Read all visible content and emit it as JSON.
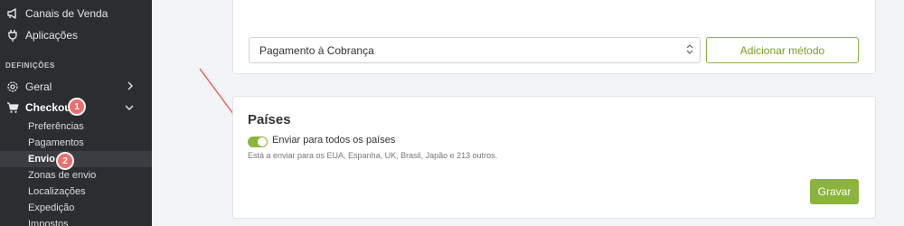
{
  "sidebar": {
    "top_items": [
      {
        "label": "Canais de Venda",
        "icon": "megaphone-icon"
      },
      {
        "label": "Aplicações",
        "icon": "plug-icon"
      }
    ],
    "section_label": "DEFINIÇÕES",
    "items": [
      {
        "label": "Geral",
        "icon": "gear-icon"
      },
      {
        "label": "Checkout",
        "icon": "cart-icon"
      }
    ],
    "checkout_children": [
      "Preferências",
      "Pagamentos",
      "Envio",
      "Zonas de envio",
      "Localizações",
      "Expedição",
      "Impostos"
    ],
    "badges": [
      "1",
      "2"
    ]
  },
  "payment": {
    "selected": "Pagamento à Cobrança",
    "add_button": "Adicionar método"
  },
  "countries": {
    "title": "Países",
    "toggle_label": "Enviar para todos os países",
    "toggle_on": true,
    "hint": "Está a enviar para os EUA, Espanha, UK, Brasil, Japão e 213 outros.",
    "save_button": "Gravar"
  },
  "colors": {
    "accent": "#8cb43c",
    "sidebar_bg": "#2b2d31",
    "badge": "#e8706d",
    "annotation_arrow": "#e46b6b"
  }
}
